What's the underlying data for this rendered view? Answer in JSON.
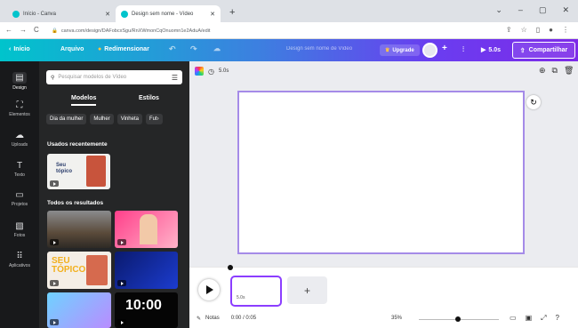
{
  "browser": {
    "tabs": [
      {
        "title": "Início - Canva",
        "close": "✕"
      },
      {
        "title": "Design sem nome - Vídeo",
        "close": "✕"
      }
    ],
    "new_tab": "+",
    "window_controls": [
      "⌄",
      "–",
      "▢",
      "✕"
    ],
    "url": "canva.com/design/DAFobcxSgu/RnXWmonCqOnuomn1e2AduA/edit",
    "nav": [
      "←",
      "→",
      "C"
    ]
  },
  "topbar": {
    "home": "Início",
    "file": "Arquivo",
    "resize": "Redimensionar",
    "undo": "↶",
    "redo": "↷",
    "cloud": "☁",
    "design_title": "Design sem nome de Vídeo",
    "upgrade": "Upgrade",
    "plus": "+",
    "chart": "⫶",
    "play_time": "5.0s",
    "share": "Compartilhar",
    "accent": "#7d2ae8"
  },
  "rail": [
    {
      "label": "Design",
      "icon": "layout-icon"
    },
    {
      "label": "Elementos",
      "icon": "elements-icon"
    },
    {
      "label": "Uploads",
      "icon": "upload-icon"
    },
    {
      "label": "Texto",
      "icon": "text-icon"
    },
    {
      "label": "Projetos",
      "icon": "folder-icon"
    },
    {
      "label": "Fotos",
      "icon": "photos-icon"
    },
    {
      "label": "Aplicativos",
      "icon": "apps-icon"
    }
  ],
  "panel": {
    "search_placeholder": "Pesquisar modelos de Vídeo",
    "tabs": [
      "Modelos",
      "Estilos"
    ],
    "chips": [
      "Dia da mulher",
      "Mulher",
      "Vinheta",
      "Fut›"
    ],
    "recent_heading": "Usados recentemente",
    "recent_thumb_text": "Seu tópico",
    "results_heading": "Todos os resultados",
    "result_texts": [
      "SEU TÓPICO",
      "10:00"
    ]
  },
  "canvas": {
    "duration": "5.0s",
    "clip_duration": "5.0s"
  },
  "timeline": {
    "add": "+"
  },
  "footer": {
    "notes": "Notas",
    "time": "0:00 / 0:05",
    "zoom": "35%",
    "zoom_level": 0.35
  }
}
